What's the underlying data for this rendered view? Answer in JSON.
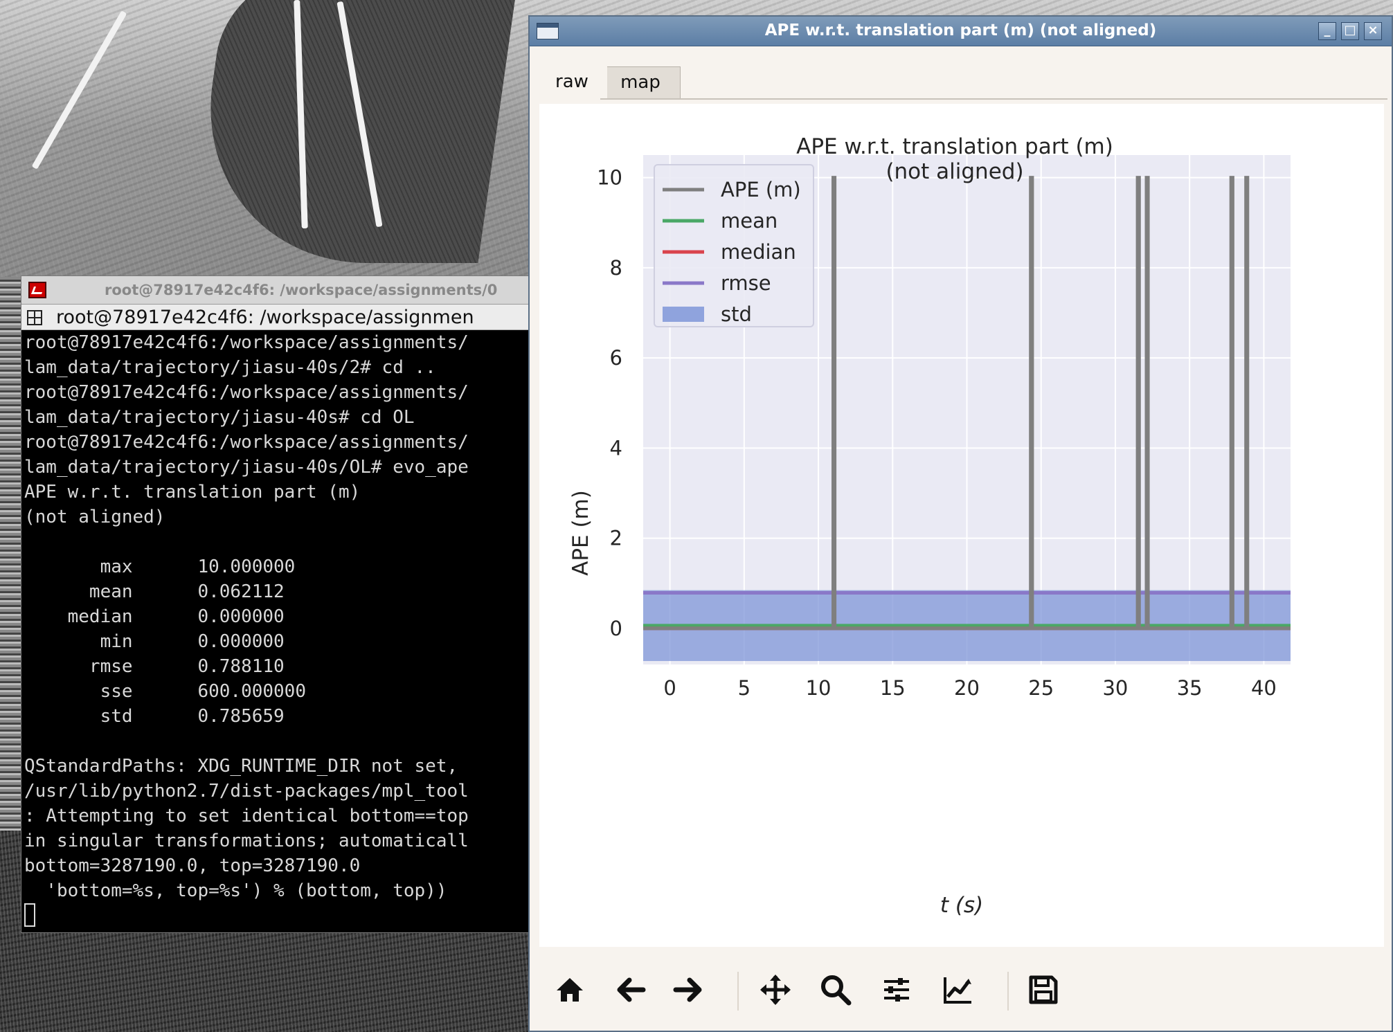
{
  "terminal": {
    "window_title": "root@78917e42c4f6: /workspace/assignments/0",
    "tab_title": "root@78917e42c4f6: /workspace/assignmen",
    "lines": [
      "root@78917e42c4f6:/workspace/assignments/",
      "lam_data/trajectory/jiasu-40s/2# cd ..",
      "root@78917e42c4f6:/workspace/assignments/",
      "lam_data/trajectory/jiasu-40s# cd OL",
      "root@78917e42c4f6:/workspace/assignments/",
      "lam_data/trajectory/jiasu-40s/OL# evo_ape",
      "APE w.r.t. translation part (m)",
      "(not aligned)",
      "",
      "       max      10.000000",
      "      mean      0.062112",
      "    median      0.000000",
      "       min      0.000000",
      "      rmse      0.788110",
      "       sse      600.000000",
      "       std      0.785659",
      "",
      "QStandardPaths: XDG_RUNTIME_DIR not set,",
      "/usr/lib/python2.7/dist-packages/mpl_tool",
      ": Attempting to set identical bottom==top",
      "in singular transformations; automaticall",
      "bottom=3287190.0, top=3287190.0",
      "  'bottom=%s, top=%s') % (bottom, top))"
    ]
  },
  "figure_window": {
    "title": "APE w.r.t. translation part (m) (not aligned)",
    "buttons": {
      "minimize": "_",
      "maximize": "□",
      "close": "×"
    },
    "tabs": [
      {
        "label": "raw",
        "active": true
      },
      {
        "label": "map",
        "active": false
      }
    ],
    "toolbar": [
      {
        "name": "home-icon"
      },
      {
        "name": "back-arrow-icon"
      },
      {
        "name": "forward-arrow-icon"
      },
      {
        "name": "pan-move-icon"
      },
      {
        "name": "zoom-magnifier-icon"
      },
      {
        "name": "subplots-config-icon"
      },
      {
        "name": "edit-axes-icon"
      },
      {
        "name": "save-disk-icon"
      }
    ]
  },
  "chart_data": {
    "type": "line",
    "title": "APE w.r.t. translation part (m)",
    "subtitle": "(not aligned)",
    "xlabel": "t (s)",
    "ylabel": "APE (m)",
    "xlim": [
      -1.8,
      41.8
    ],
    "ylim": [
      -0.8,
      10.5
    ],
    "xticks": [
      0,
      5,
      10,
      15,
      20,
      25,
      30,
      35,
      40
    ],
    "yticks": [
      0,
      2,
      4,
      6,
      8,
      10
    ],
    "grid": true,
    "legend_position": "top-left",
    "colors": {
      "ape": "#7f7f7f",
      "mean": "#4aa866",
      "median": "#d9434c",
      "rmse": "#8a78c8",
      "std": "#7f96d8",
      "plot_bg": "#eaeaf4"
    },
    "series": [
      {
        "name": "APE (m)",
        "kind": "line",
        "x": [
          -1.8,
          11.0,
          11.0,
          11.1,
          11.1,
          24.3,
          24.3,
          24.4,
          24.4,
          31.5,
          31.5,
          31.6,
          31.6,
          32.1,
          32.1,
          32.2,
          32.2,
          37.8,
          37.8,
          37.9,
          37.9,
          38.8,
          38.8,
          38.9,
          38.9,
          41.8
        ],
        "y": [
          0,
          0,
          10,
          10,
          0,
          0,
          10,
          10,
          0,
          0,
          10,
          10,
          0,
          0,
          10,
          10,
          0,
          0,
          10,
          10,
          0,
          0,
          10,
          10,
          0,
          0
        ]
      },
      {
        "name": "mean",
        "kind": "hline",
        "value": 0.062112
      },
      {
        "name": "median",
        "kind": "hline",
        "value": 0.0
      },
      {
        "name": "rmse",
        "kind": "hline",
        "value": 0.78811
      },
      {
        "name": "std",
        "kind": "band",
        "center": 0.062112,
        "halfwidth": 0.785659
      }
    ]
  }
}
